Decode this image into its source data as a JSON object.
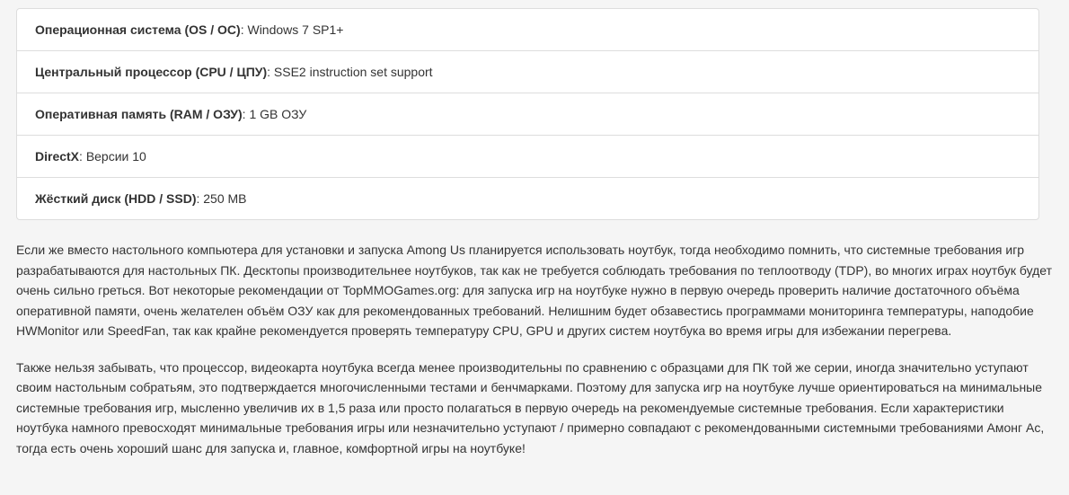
{
  "requirements": [
    {
      "label": "Операционная система (OS / ОС)",
      "value": "Windows 7 SP1+"
    },
    {
      "label": "Центральный процессор (CPU / ЦПУ)",
      "value": "SSE2 instruction set support"
    },
    {
      "label": "Оперативная память (RAM / ОЗУ)",
      "value": "1 GB ОЗУ"
    },
    {
      "label": "DirectX",
      "value": "Версии 10"
    },
    {
      "label": "Жёсткий диск (HDD / SSD)",
      "value": "250 MB"
    }
  ],
  "separator": ": ",
  "paragraphs": [
    "Если же вместо настольного компьютера для установки и запуска Among Us планируется использовать ноутбук, тогда необходимо помнить, что системные требования игр разрабатываются для настольных ПК. Десктопы производительнее ноутбуков, так как не требуется соблюдать требования по теплоотводу (TDP), во многих играх ноутбук будет очень сильно греться. Вот некоторые рекомендации от TopMMOGames.org: для запуска игр на ноутбуке нужно в первую очередь проверить наличие достаточного объёма оперативной памяти, очень желателен объём ОЗУ как для рекомендованных требований. Нелишним будет обзавестись программами мониторинга температуры, наподобие HWMonitor или SpeedFan, так как крайне рекомендуется проверять температуру CPU, GPU и других систем ноутбука во время игры для избежании перегрева.",
    "Также нельзя забывать, что процессор, видеокарта ноутбука всегда менее производительны по сравнению с образцами для ПК той же серии, иногда значительно уступают своим настольным собратьям, это подтверждается многочисленными тестами и бенчмарками. Поэтому для запуска игр на ноутбуке лучше ориентироваться на минимальные системные требования игр, мысленно увеличив их в 1,5 раза или просто полагаться в первую очередь на рекомендуемые системные требования. Если характеристики ноутбука намного превосходят минимальные требования игры или незначительно уступают / примерно совпадают с рекомендованными системными требованиями Амонг Ас, тогда есть очень хороший шанс для запуска и, главное, комфортной игры на ноутбуке!"
  ]
}
